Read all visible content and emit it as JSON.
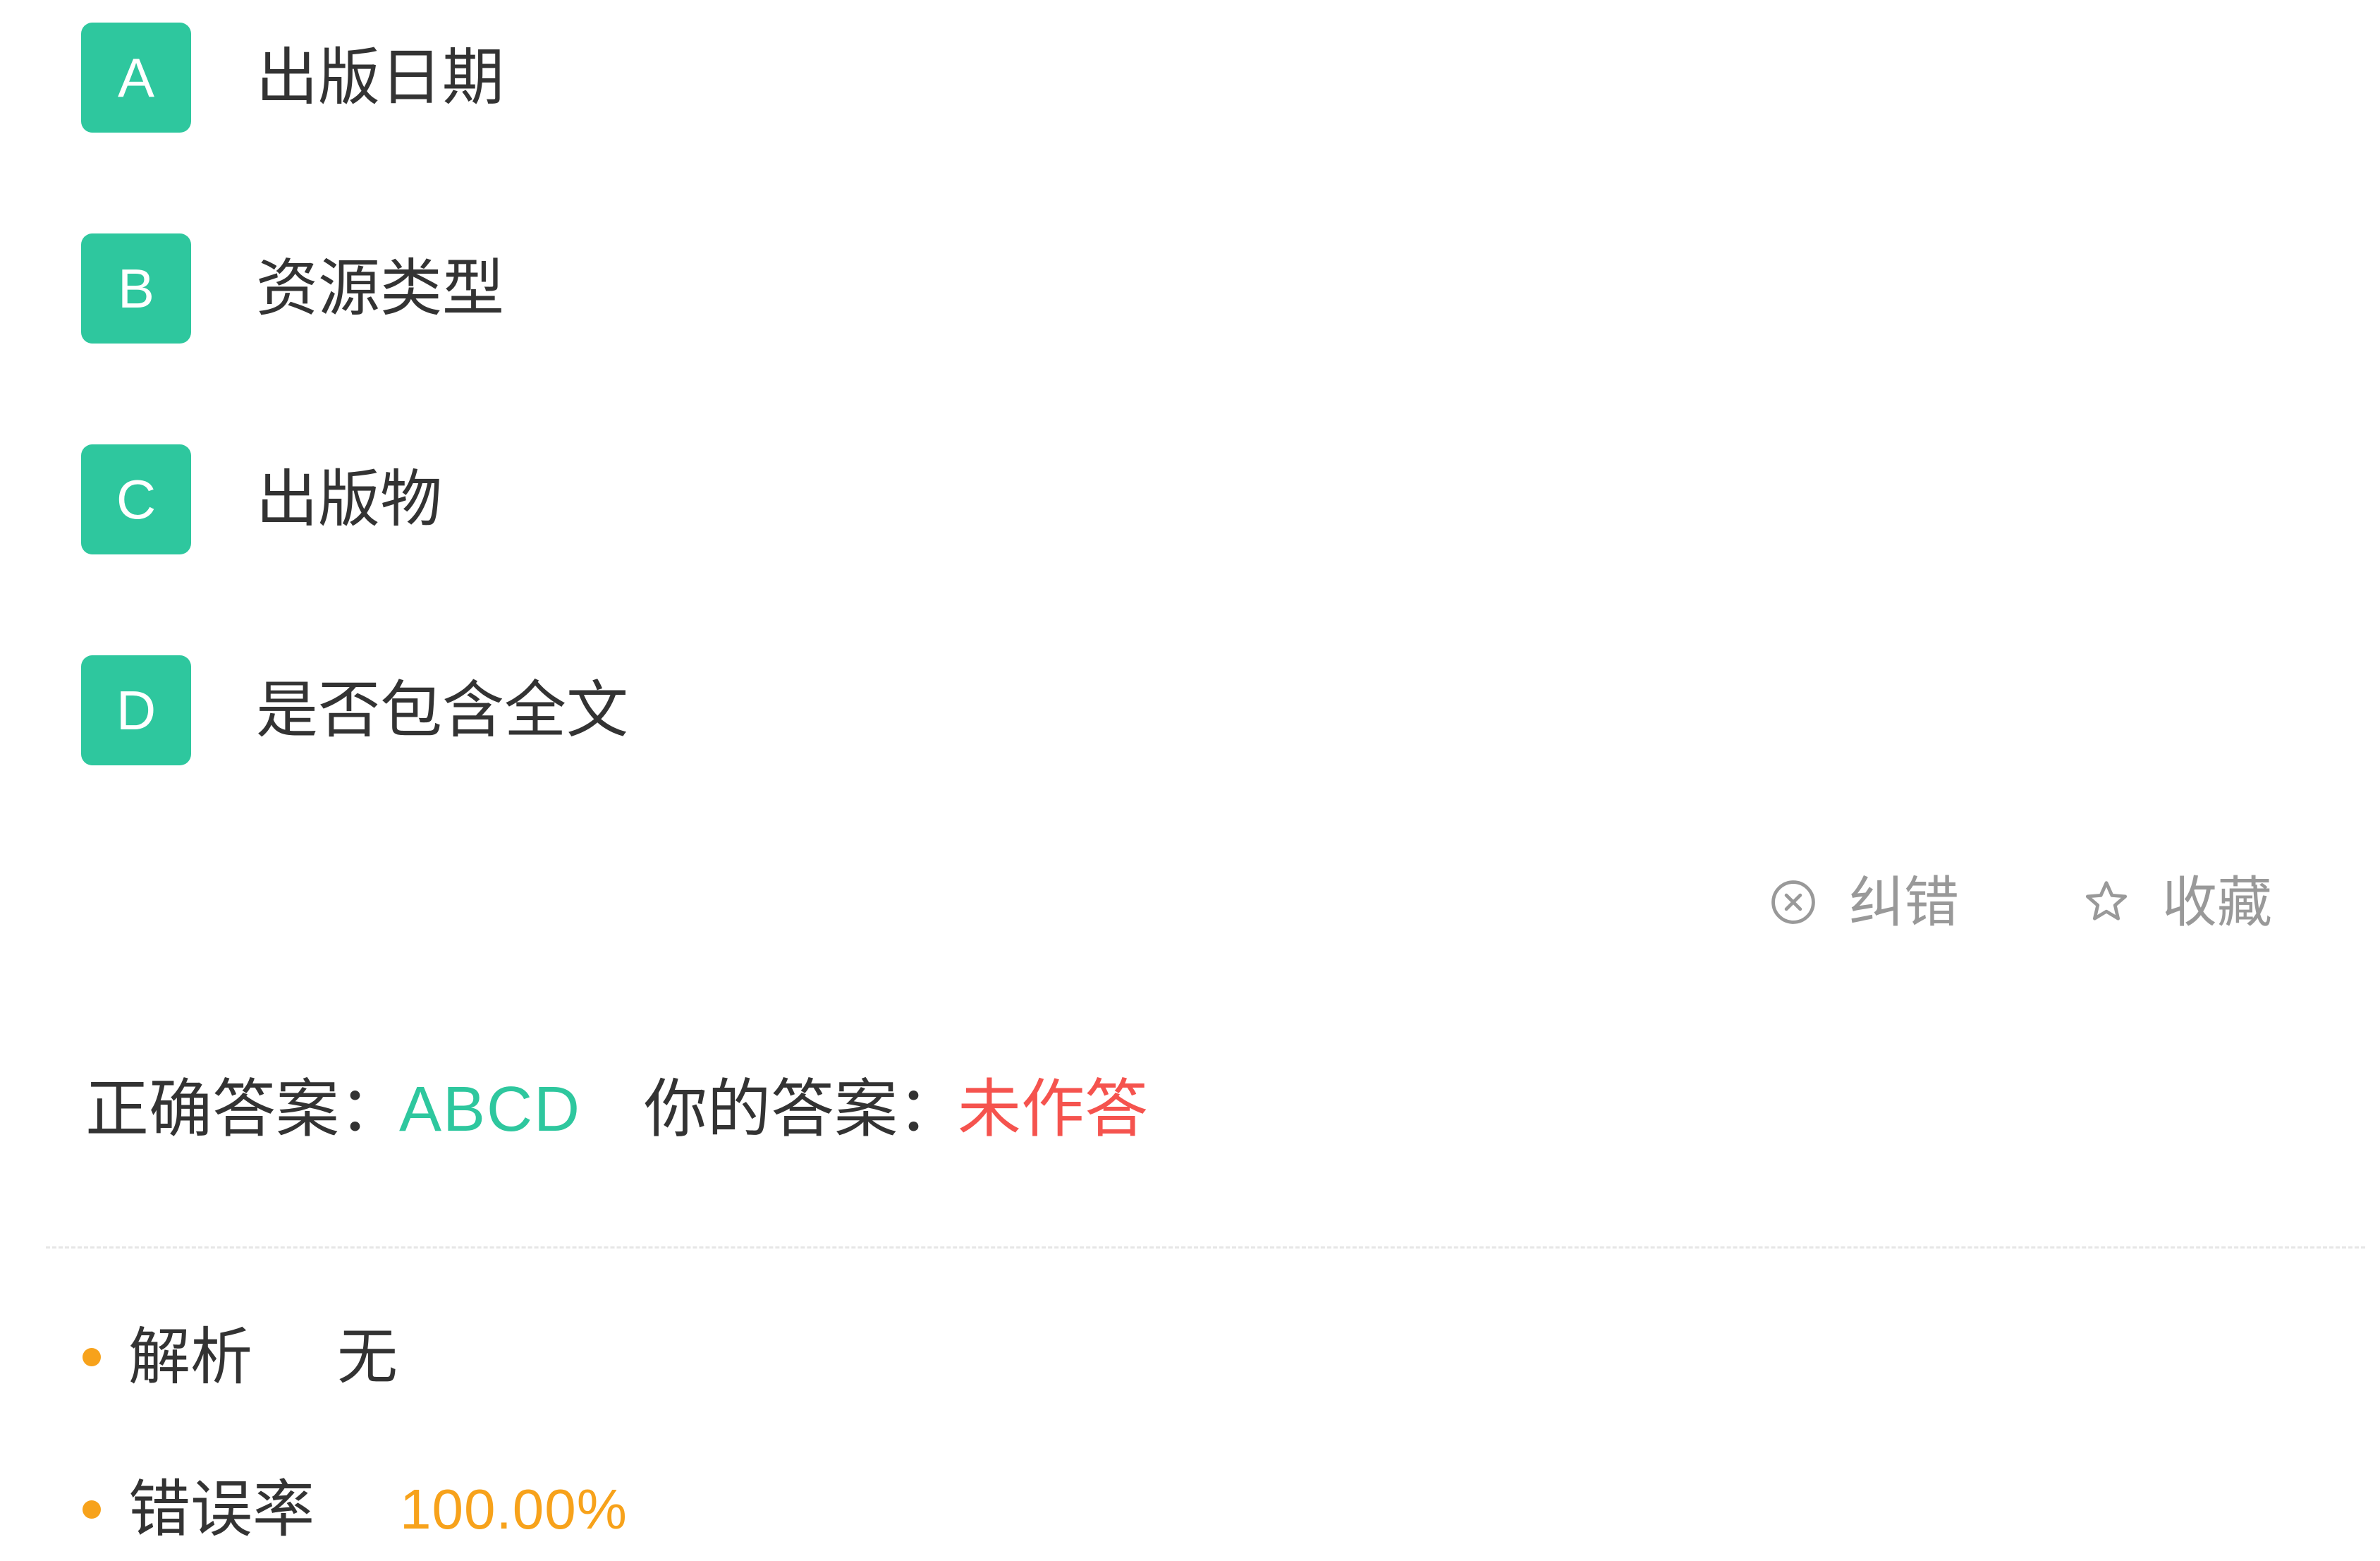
{
  "options": [
    {
      "letter": "A",
      "text": "出版日期"
    },
    {
      "letter": "B",
      "text": "资源类型"
    },
    {
      "letter": "C",
      "text": "出版物"
    },
    {
      "letter": "D",
      "text": "是否包含全文"
    }
  ],
  "actions": {
    "report_label": "纠错",
    "report_icon": "circle-x-icon",
    "favorite_label": "收藏",
    "favorite_icon": "star-outline-icon"
  },
  "answer": {
    "correct_label": "正确答案：",
    "correct_value": "ABCD",
    "yours_label": "你的答案：",
    "yours_value": "未作答"
  },
  "analysis": {
    "label": "解析",
    "value": "无"
  },
  "error_rate": {
    "label": "错误率",
    "value": "100.00%"
  },
  "colors": {
    "accent": "#2ec79e",
    "error": "#f5534e",
    "warning": "#f7a21b",
    "muted": "#999999",
    "text": "#333333"
  }
}
